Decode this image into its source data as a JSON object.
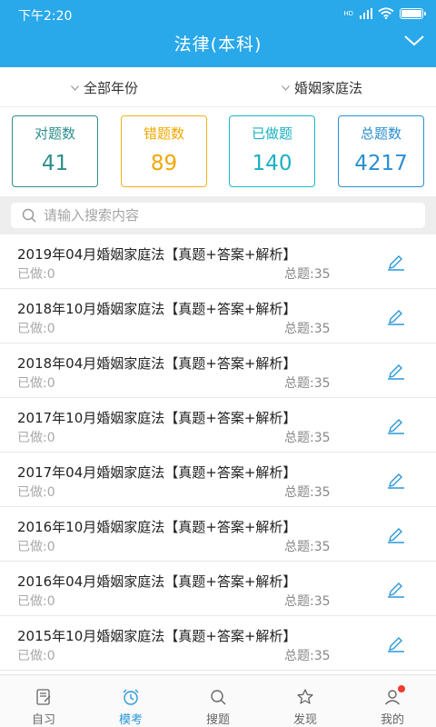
{
  "status": {
    "time": "下午2:20",
    "signal_label": "HD"
  },
  "header": {
    "title": "法律(本科)"
  },
  "filters": {
    "year": "全部年份",
    "subject": "婚姻家庭法"
  },
  "stats": [
    {
      "label": "对题数",
      "value": "41"
    },
    {
      "label": "错题数",
      "value": "89"
    },
    {
      "label": "已做题",
      "value": "140"
    },
    {
      "label": "总题数",
      "value": "4217"
    }
  ],
  "search": {
    "placeholder": "请输入搜索内容"
  },
  "list": [
    {
      "title": "2019年04月婚姻家庭法【真题+答案+解析】",
      "done": "已做:0",
      "total": "总题:35"
    },
    {
      "title": "2018年10月婚姻家庭法【真题+答案+解析】",
      "done": "已做:0",
      "total": "总题:35"
    },
    {
      "title": "2018年04月婚姻家庭法【真题+答案+解析】",
      "done": "已做:0",
      "total": "总题:35"
    },
    {
      "title": "2017年10月婚姻家庭法【真题+答案+解析】",
      "done": "已做:0",
      "total": "总题:35"
    },
    {
      "title": "2017年04月婚姻家庭法【真题+答案+解析】",
      "done": "已做:0",
      "total": "总题:35"
    },
    {
      "title": "2016年10月婚姻家庭法【真题+答案+解析】",
      "done": "已做:0",
      "total": "总题:35"
    },
    {
      "title": "2016年04月婚姻家庭法【真题+答案+解析】",
      "done": "已做:0",
      "total": "总题:35"
    },
    {
      "title": "2015年10月婚姻家庭法【真题+答案+解析】",
      "done": "已做:0",
      "total": "总题:35"
    }
  ],
  "tabs": [
    {
      "label": "自习",
      "icon": "notebook-icon"
    },
    {
      "label": "模考",
      "icon": "alarm-clock-icon",
      "active": true
    },
    {
      "label": "搜题",
      "icon": "search-icon"
    },
    {
      "label": "发现",
      "icon": "star-icon"
    },
    {
      "label": "我的",
      "icon": "user-icon",
      "badge": true
    }
  ],
  "colors": {
    "primary": "#29a8ea",
    "correct": "#2c8f8c",
    "wrong": "#f0a800",
    "done": "#19b1c2",
    "total": "#2a8fd2",
    "badge": "#f03b2e"
  }
}
